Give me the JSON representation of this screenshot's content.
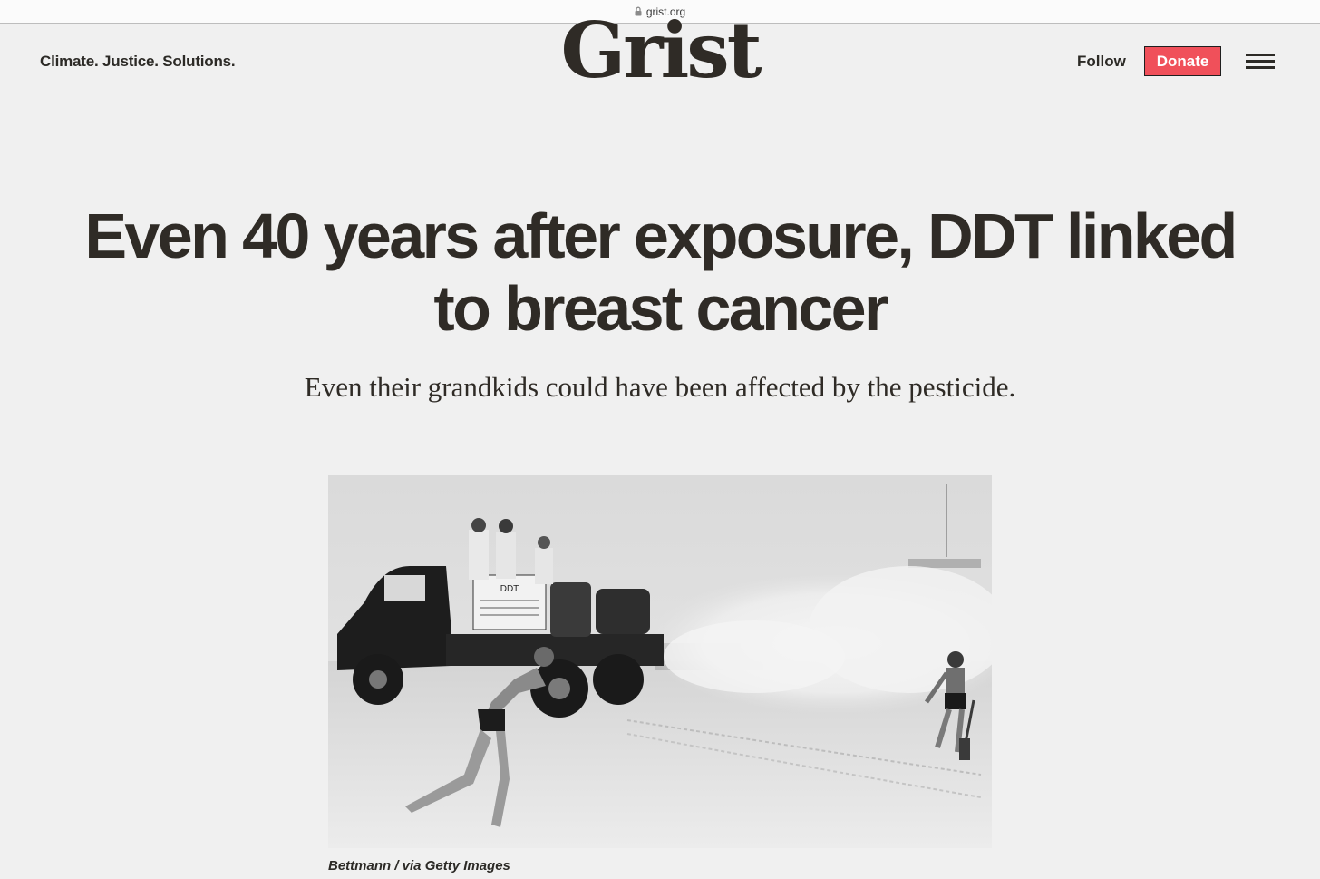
{
  "browser": {
    "url": "grist.org"
  },
  "header": {
    "tagline": "Climate. Justice. Solutions.",
    "logo": "Grist",
    "follow_label": "Follow",
    "donate_label": "Donate",
    "menu_icon": "hamburger-menu-icon"
  },
  "article": {
    "headline_line1": "Even 40 years after exposure, DDT linked",
    "headline_line2": "to breast cancer",
    "dek": "Even their grandkids could have been affected by the pesticide.",
    "image_caption": "Bettmann / via Getty Images",
    "image_sign_title": "DDT"
  },
  "colors": {
    "background": "#f0f0f0",
    "text": "#2f2b26",
    "donate_bg": "#f0505a"
  }
}
